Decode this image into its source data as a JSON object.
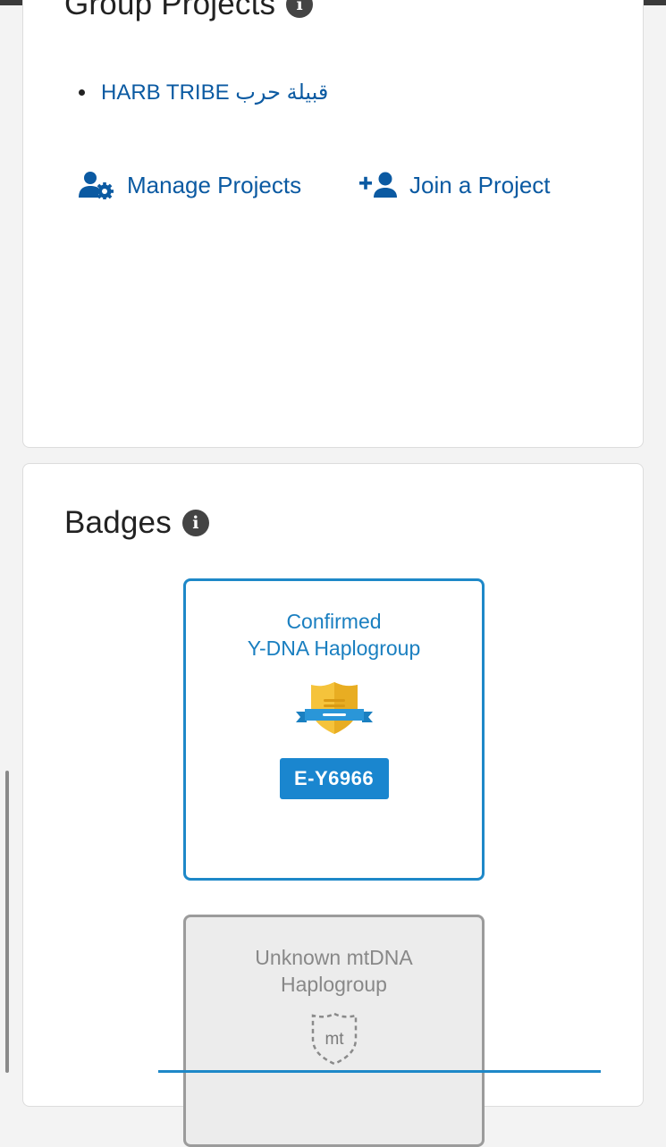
{
  "group_projects": {
    "title": "Group Projects",
    "projects": [
      "HARB TRIBE قبيلة حرب"
    ],
    "manage_label": "Manage Projects",
    "join_label": "Join a Project"
  },
  "badges": {
    "title": "Badges",
    "ydna": {
      "title_line1": "Confirmed",
      "title_line2": "Y-DNA Haplogroup",
      "haplogroup": "E-Y6966"
    },
    "mtdna": {
      "title_line1": "Unknown mtDNA",
      "title_line2": "Haplogroup",
      "icon_text": "mt"
    }
  },
  "colors": {
    "link": "#0b5aa2",
    "accent": "#1a86cf",
    "badge_gold": "#f5c33b"
  }
}
